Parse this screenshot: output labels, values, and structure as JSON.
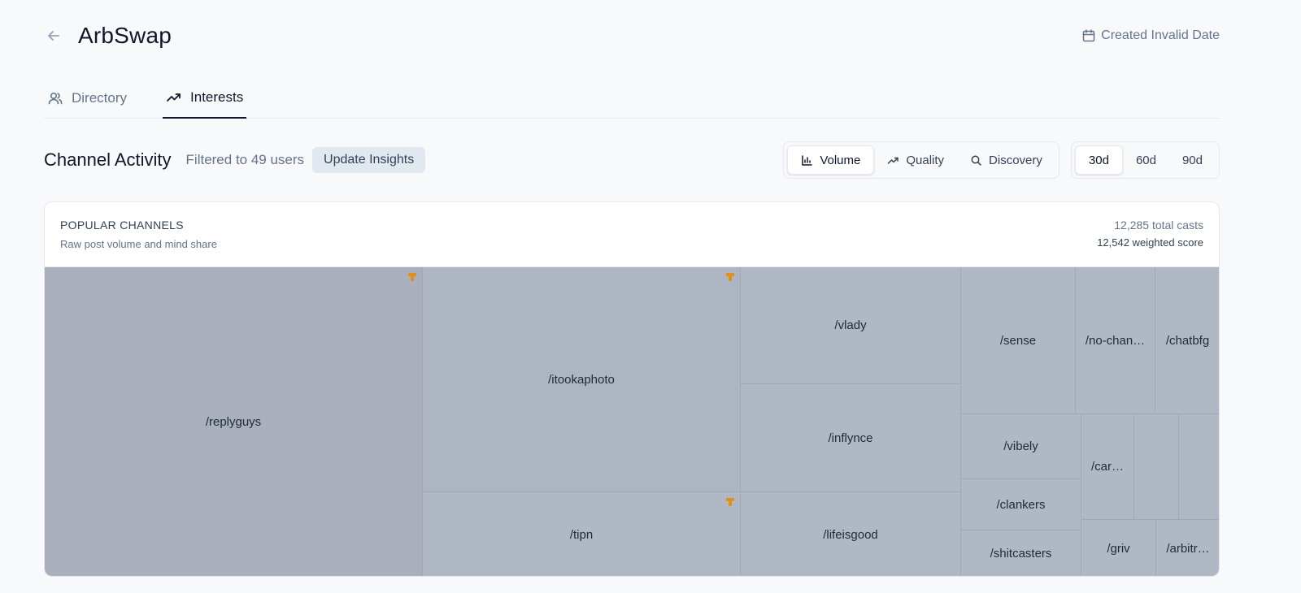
{
  "header": {
    "title": "ArbSwap",
    "created": "Created Invalid Date"
  },
  "tabs": [
    {
      "label": "Directory",
      "icon": "users-icon"
    },
    {
      "label": "Interests",
      "icon": "trending-up-icon"
    }
  ],
  "activity": {
    "title": "Channel Activity",
    "filtered": "Filtered to 49 users",
    "update_label": "Update Insights",
    "modes": [
      {
        "label": "Volume",
        "icon": "bar-chart-icon"
      },
      {
        "label": "Quality",
        "icon": "trending-up-icon"
      },
      {
        "label": "Discovery",
        "icon": "search-icon"
      }
    ],
    "ranges": [
      "30d",
      "60d",
      "90d"
    ]
  },
  "card": {
    "title": "POPULAR CHANNELS",
    "subtitle": "Raw post volume and mind share",
    "total_casts": "12,285 total casts",
    "weighted": "12,542 weighted score"
  },
  "treemap": {
    "colors": {
      "dark": "#a9b0bb",
      "mid": "#adb5c1",
      "light": "#b0b8c3",
      "badge": "#e0901c"
    },
    "cells": [
      {
        "label": "/replyguys",
        "tone": "dark",
        "badge": true
      },
      {
        "label": "/itookaphoto",
        "tone": "mid",
        "badge": true
      },
      {
        "label": "/tipn",
        "tone": "light",
        "badge": true
      },
      {
        "label": "/vlady",
        "tone": "light",
        "badge": false
      },
      {
        "label": "/inflynce",
        "tone": "light",
        "badge": false
      },
      {
        "label": "/lifeisgood",
        "tone": "light",
        "badge": false
      },
      {
        "label": "/sense",
        "tone": "light",
        "badge": false
      },
      {
        "label": "/no-chan…",
        "tone": "light",
        "badge": false
      },
      {
        "label": "/chatbfg",
        "tone": "light",
        "badge": false
      },
      {
        "label": "/vibely",
        "tone": "light",
        "badge": false
      },
      {
        "label": "/clankers",
        "tone": "light",
        "badge": false
      },
      {
        "label": "/shitcasters",
        "tone": "light",
        "badge": false
      },
      {
        "label": "/car…",
        "tone": "light",
        "badge": false
      },
      {
        "label": "",
        "tone": "light",
        "badge": false
      },
      {
        "label": "",
        "tone": "light",
        "badge": false
      },
      {
        "label": "/griv",
        "tone": "light",
        "badge": false
      },
      {
        "label": "/arbitr…",
        "tone": "light",
        "badge": false
      }
    ]
  }
}
